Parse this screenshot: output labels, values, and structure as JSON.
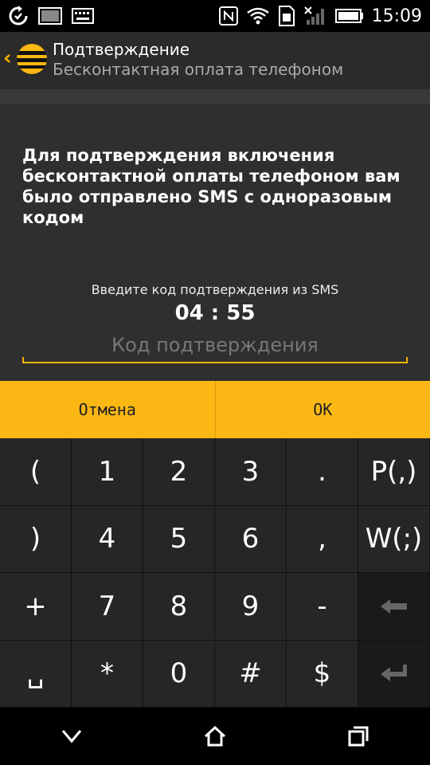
{
  "status_bar": {
    "time": "15:09",
    "icons": [
      "sync-icon",
      "screenshot-icon",
      "keyboard-icon",
      "nfc-icon",
      "wifi-icon",
      "sim-icon",
      "no-signal-icon",
      "battery-icon"
    ]
  },
  "header": {
    "title": "Подтверждение",
    "subtitle": "Бесконтактная оплата телефоном"
  },
  "dialog": {
    "message": "Для подтверждения включения бесконтактной оплаты телефоном вам было отправлено SMS с одноразовым кодом",
    "prompt": "Введите код подтверждения из SMS",
    "timer": "04 : 55",
    "input": {
      "value": "",
      "placeholder": "Код подтверждения"
    },
    "buttons": {
      "cancel": "Отмена",
      "ok": "OK"
    }
  },
  "keypad": {
    "keys": [
      "(",
      "1",
      "2",
      "3",
      ".",
      "P(,)",
      ")",
      "4",
      "5",
      "6",
      ",",
      "W(;)",
      "+",
      "7",
      "8",
      "9",
      "-",
      "",
      "␣",
      "*",
      "0",
      "#",
      "$",
      ""
    ]
  },
  "colors": {
    "accent": "#fbb714",
    "underline": "#f4b400"
  }
}
